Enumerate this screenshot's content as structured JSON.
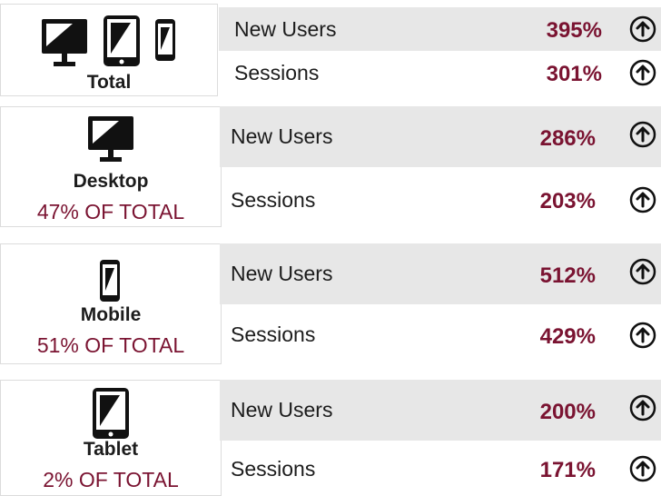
{
  "colors": {
    "accent": "#7a1331",
    "row_grey": "#e7e7e7",
    "icon": "#111111"
  },
  "sections": [
    {
      "label": "Total",
      "share": "",
      "icons": [
        "desktop-icon",
        "tablet-icon",
        "mobile-icon"
      ],
      "rows": [
        {
          "metric": "New Users",
          "value": "395%",
          "trend": "up-arrow-icon"
        },
        {
          "metric": "Sessions",
          "value": "301%",
          "trend": "up-arrow-icon"
        }
      ]
    },
    {
      "label": "Desktop",
      "share": "47% OF TOTAL",
      "icons": [
        "desktop-icon"
      ],
      "rows": [
        {
          "metric": "New Users",
          "value": "286%",
          "trend": "up-arrow-icon"
        },
        {
          "metric": "Sessions",
          "value": "203%",
          "trend": "up-arrow-icon"
        }
      ]
    },
    {
      "label": "Mobile",
      "share": "51% OF TOTAL",
      "icons": [
        "mobile-icon"
      ],
      "rows": [
        {
          "metric": "New Users",
          "value": "512%",
          "trend": "up-arrow-icon"
        },
        {
          "metric": "Sessions",
          "value": "429%",
          "trend": "up-arrow-icon"
        }
      ]
    },
    {
      "label": "Tablet",
      "share": "2% OF TOTAL",
      "icons": [
        "tablet-icon"
      ],
      "rows": [
        {
          "metric": "New Users",
          "value": "200%",
          "trend": "up-arrow-icon"
        },
        {
          "metric": "Sessions",
          "value": "171%",
          "trend": "up-arrow-icon"
        }
      ]
    }
  ]
}
